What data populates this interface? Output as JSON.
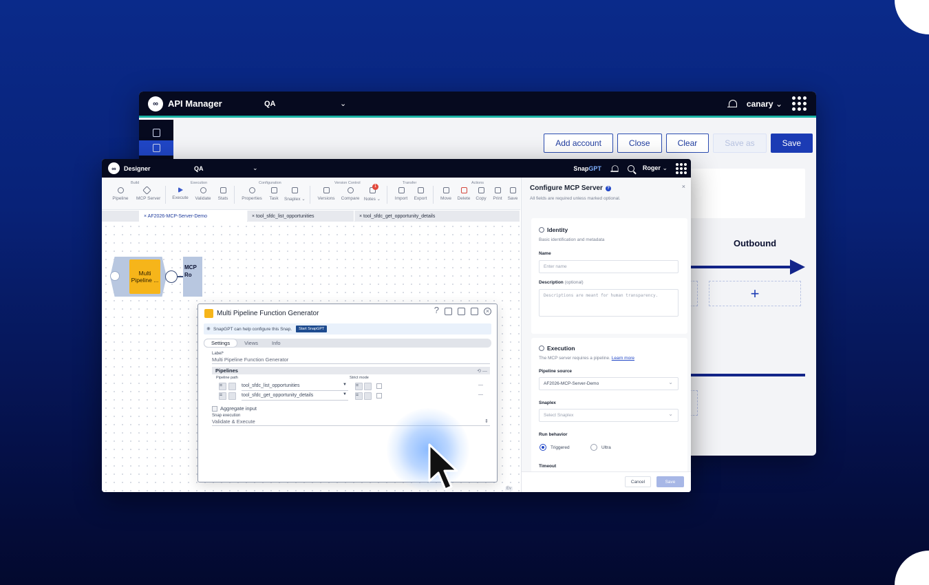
{
  "api_manager": {
    "title": "API Manager",
    "env": "QA",
    "user": "canary",
    "buttons": {
      "add_account": "Add account",
      "close": "Close",
      "clear": "Clear",
      "save_as": "Save as",
      "save": "Save"
    },
    "outbound_label": "Outbound",
    "add_symbol": "+"
  },
  "designer": {
    "title": "Designer",
    "env": "QA",
    "snapgpt_prefix": "Snap",
    "snapgpt_suffix": "GPT",
    "user": "Roger",
    "toolbar": {
      "groups": {
        "build": "Build",
        "execution": "Execution",
        "configuration": "Configuration",
        "version_control": "Version Control",
        "transfer": "Transfer",
        "actions": "Actions"
      },
      "items": {
        "pipeline": "Pipeline",
        "mcp_server": "MCP Server",
        "execute": "Execute",
        "validate": "Validate",
        "stats": "Stats",
        "properties": "Properties",
        "task": "Task",
        "snaplex": "Snaplex ⌄",
        "versions": "Versions",
        "compare": "Compare",
        "notes": "Notes ⌄",
        "import": "Import",
        "export": "Export",
        "move": "Move",
        "delete": "Delete",
        "copy": "Copy",
        "print": "Print",
        "save": "Save"
      },
      "notes_badge": "1"
    },
    "tabs": [
      "× AF2026-MCP-Server-Demo",
      "× tool_sfdc_list_opportunities",
      "× tool_sfdc_get_opportunity_details"
    ],
    "canvas": {
      "snap_label_line1": "Multi",
      "snap_label_line2": "Pipeline ...",
      "snap2_line1": "MCP",
      "snap2_line2": "Ro",
      "corner_badge": "Ev"
    }
  },
  "snap_dialog": {
    "title": "Multi Pipeline Function Generator",
    "help": "?",
    "gpt_text": "SnapGPT can help configure this Snap.",
    "gpt_button": "Start SnapGPT",
    "tabs": [
      "Settings",
      "Views",
      "Info"
    ],
    "label_field_label": "Label*",
    "label_field_value": "Multi Pipeline Function Generator",
    "pipelines_header": "Pipelines",
    "pipeline_path_col": "Pipeline path",
    "strict_mode_col": "Strict mode",
    "rows": [
      "tool_sfdc_list_opportunities",
      "tool_sfdc_get_opportunity_details"
    ],
    "row_btn": "=",
    "row_dash": "—",
    "aggregate_label": "Aggregate input",
    "snap_exec_label": "Snap execution",
    "snap_exec_value": "Validate & Execute"
  },
  "mcp_panel": {
    "title": "Configure MCP Server",
    "q_badge": "?",
    "close": "×",
    "subtitle": "All fields are required unless marked optional.",
    "identity": {
      "title": "Identity",
      "subtitle": "Basic identification and metadata",
      "name_label": "Name",
      "name_placeholder": "Enter name",
      "desc_label": "Description",
      "desc_optional": "(optional)",
      "desc_placeholder": "Descriptions are meant for human transparency."
    },
    "execution": {
      "title": "Execution",
      "subtitle": "The MCP server requires a pipeline.",
      "learn_more": "Learn more",
      "pipeline_source_label": "Pipeline source",
      "pipeline_source_value": "AF2026-MCP-Server-Demo",
      "snaplex_label": "Snaplex",
      "snaplex_placeholder": "Select Snaplex",
      "run_behavior_label": "Run behavior",
      "run_options": [
        "Triggered",
        "Ultra"
      ],
      "timeout_label": "Timeout"
    },
    "footer": {
      "cancel": "Cancel",
      "save": "Save"
    }
  }
}
